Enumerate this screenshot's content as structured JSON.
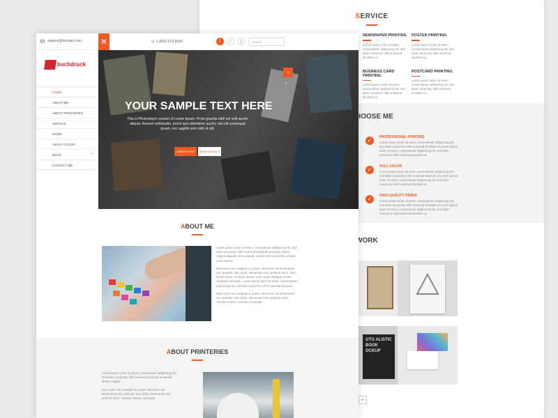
{
  "colors": {
    "accent": "#ef5a24",
    "text": "#555555"
  },
  "back_page": {
    "service": {
      "title_first": "S",
      "title_rest": "ERVICE",
      "items": [
        {
          "title": "NEWSPAPER PRINTING",
          "text": "Lorem ipsum dolor sit amet, consectetuer adipiscing elit, sed diam nonummy nibh euismod tincidunt ut"
        },
        {
          "title": "POSTER PRINTING",
          "text": "Lorem ipsum dolor sit amet, consectetuer adipiscing elit, sed diam nonummy nibh euismod tincidunt ut"
        },
        {
          "title": "BUSINESS CARD PRINTING",
          "text": "Lorem ipsum dolor sit amet, consectetuer adipiscing elit, sed diam nonummy nibh euismod tincidunt ut"
        },
        {
          "title": "POSTCARD PRINTING",
          "text": "Lorem ipsum dolor sit amet, consectetuer adipiscing elit, sed diam nonummy nibh euismod tincidunt ut"
        }
      ]
    },
    "choose": {
      "title_first": "",
      "title_rest": "HOOSE ME",
      "items": [
        {
          "title": "PROFESSIONAL PRINTING",
          "text": "Lorem ipsum dolor sit amet, consectetuer adipiscing elit, sed diam nonummy nibh euismod tincidunt ut Lorem ipsum dolor sit amet, consectetuer adipiscing elit, sed diam nonummy nibh euismod tincidunt ut"
        },
        {
          "title": "FULL COLOR",
          "text": "Lorem ipsum dolor sit amet, consectetuer adipiscing elit, sed diam nonummy nibh euismod tincidunt ut Lorem ipsum dolor sit amet, consectetuer adipiscing elit, sed diam nonummy nibh euismod tincidunt ut"
        },
        {
          "title": "HIGH QUALITY PAPER",
          "text": "Lorem ipsum dolor sit amet, consectetuer adipiscing elit, sed diam nonummy nibh euismod tincidunt ut Lorem ipsum dolor sit amet, consectetuer adipiscing elit, sed diam nonummy nibh euismod tincidunt ut"
        }
      ]
    },
    "work": {
      "title_first": "",
      "title_rest": "WORK"
    }
  },
  "front_page": {
    "topbar": {
      "email": "support@domain.com",
      "close_symbol": "✕",
      "phone": "1 (800) 614 8090",
      "social": [
        "f",
        "t",
        "g"
      ],
      "search_placeholder": "Search"
    },
    "logo_text": "buchdruck",
    "nav": [
      {
        "label": "HOME",
        "active": true
      },
      {
        "label": "ABOUT ME"
      },
      {
        "label": "ABOUT PRINTERIES"
      },
      {
        "label": "SERVICE"
      },
      {
        "label": "WORK"
      },
      {
        "label": "ABOUT COLOR"
      },
      {
        "label": "BOOK",
        "expand": "+"
      },
      {
        "label": "CONTACT ME"
      }
    ],
    "hero": {
      "title": "YOUR SAMPLE TEXT HERE",
      "description": "This is Photoshop's version of Lorem Ipsum. Proin gravida nibh vel velit auctor aliquet. Aenean sollicitudin, lorem quis bibendum auctor, nisi elit consequat ipsum, nec sagittis sem nibh id elit.",
      "button_primary": "ORDER NOW",
      "button_secondary": "MORE DETAILS",
      "next_arrow": "›",
      "prev_arrow": "‹"
    },
    "about": {
      "title_first": "A",
      "title_rest": "BOUT ME",
      "paragraphs": [
        "Lorem ipsum dolor sit amet, consectetuer adipiscing elit, sed diam nonummy nibh euismod tincidunt ut laoreet dolore magna aliquam erat volutpat. Ut wisi enim ad minim veniam, quis nostrud",
        "Duis nunc nisl, volutpat ut, ipsum. Sed sem nisl elementum nisi, pulvinar. Nec dolor, elementum nisi, pretium tortor. Nam dictum dolor. Aenean massa. Cum sociis natoque ornare volutpat commodo. Lorem ipsum dolor sit amet, consectetuer adipiscing elit, sed diam nonummy nibh euismod tincidunt",
        "Duis nunc nisl, volutpat ut, ipsum. Sed sem nisl elementum nisi, pulvinar. Nec dolor, elementum nisi, pretium tortor. Aenean massa. Aenean commodo"
      ]
    },
    "printeries": {
      "title_first": "A",
      "title_rest": "BOUT PRINTERIES",
      "paragraphs": [
        "Lorem ipsum dolor sit amet, consectetuer adipiscing elit, sed diam nonummy nibh euismod tincidunt ut laoreet dolore magna",
        "Duis nunc nisl, volutpat ut, ipsum. Sed sem nisl elementum nisi, pulvinar. Nec dolor, elementum nisi, pretium tortor. Aenean massa commodo"
      ]
    }
  }
}
